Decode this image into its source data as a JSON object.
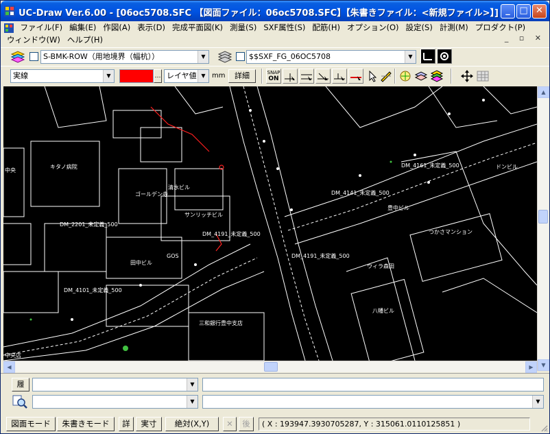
{
  "window": {
    "title": "UC-Draw Ver.6.00 - [06oc5708.SFC 【図面ファイル：06oc5708.SFC】【朱書きファイル：<新規ファイル>】]",
    "minimize_glyph": "_",
    "maximize_glyph": "□",
    "close_glyph": "✕"
  },
  "menu": {
    "row1": [
      "ファイル(F)",
      "編集(E)",
      "作図(A)",
      "表示(D)",
      "完成平面図(K)",
      "測量(S)",
      "SXF属性(S)",
      "配筋(H)",
      "オプション(O)",
      "設定(S)",
      "計測(M)",
      "プロダクト(P)"
    ],
    "row2": [
      "ウィンドウ(W)",
      "ヘルプ(H)"
    ],
    "mdi_controls": "_ ▫ ✕"
  },
  "toolbar1": {
    "layer_value": "S-BMK-ROW（用地境界（幅杭））",
    "sxf_value": "$$SXF_FG_06OC5708"
  },
  "toolbar2": {
    "linetype_value": "実線",
    "color_hex": "#ff0000",
    "ellipsis": "…",
    "width_value": "レイヤ値",
    "unit": "mm",
    "detail_label": "詳細",
    "snap_label_top": "SNAP",
    "snap_label_bottom": "ON"
  },
  "map": {
    "labels": [
      "キタノ病院",
      "中央",
      "ゴールデン寺",
      "清水ビル",
      "サンリッチビル",
      "田中ビル",
      "三和銀行豊中支店",
      "中央店",
      "豊中ビル",
      "つかさマンション",
      "ウィラ森田",
      "八幡ビル",
      "ドンビル",
      "DM_4191_未定義_500",
      "DM_4141_未定義_500",
      "DM_4101_未定義_500",
      "DM_4191_未定義_500",
      "DM_4161_未定義_500",
      "DM_2201_未定義_500",
      "GOS"
    ]
  },
  "bottom": {
    "history_label": "履",
    "combo1_value": "",
    "combo2_value": "",
    "command_value": ""
  },
  "status": {
    "mode_drawing": "図面モード",
    "mode_redline": "朱書きモード",
    "detail": "詳",
    "actual": "実寸",
    "absolute": "絶対(X,Y)",
    "x_btn": "✕",
    "back": "後",
    "coordinates": "( X : 193947.3930705287, Y : 315061.0110125851 )"
  },
  "colors": {
    "title_blue": "#0054e3",
    "canvas": "#000000",
    "map_line": "#ffffff",
    "accent_red": "#ff0000"
  }
}
